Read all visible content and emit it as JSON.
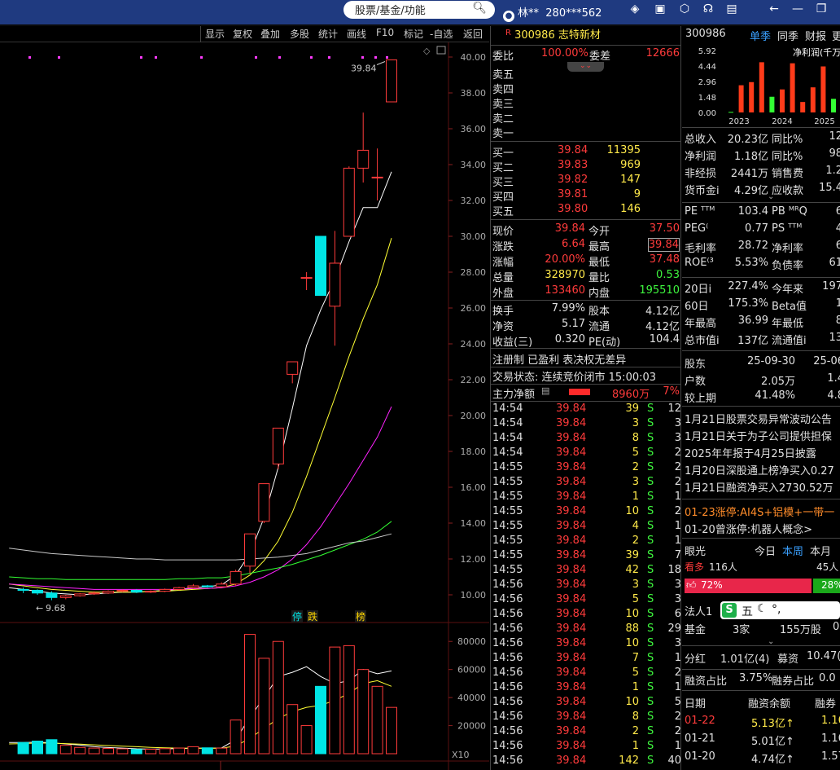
{
  "titlebar": {
    "search_placeholder": "股票/基金/功能",
    "user_name": "林**",
    "user_id": "280***562"
  },
  "chart_toolbar": [
    "显示",
    "复权",
    "叠加",
    "多股",
    "统计",
    "画线",
    "F10",
    "标记",
    "-自选",
    "返回"
  ],
  "chart_data": {
    "type": "candlestick",
    "price_ticks": [
      "40.00",
      "38.00",
      "36.00",
      "34.00",
      "32.00",
      "30.00",
      "28.00",
      "26.00",
      "24.00",
      "22.00",
      "20.00",
      "18.00",
      "16.00",
      "14.00",
      "12.00",
      "10.00"
    ],
    "volume_ticks": [
      "80000",
      "60000",
      "40000",
      "20000"
    ],
    "volume_unit": "X10",
    "price_range": [
      9.0,
      40.3
    ],
    "high_label": "39.84",
    "low_label": "9.68",
    "markers": [
      {
        "text": "停",
        "color": "#00e5e5"
      },
      {
        "text": "跌",
        "color": "#ffd700"
      },
      {
        "text": "榜",
        "color": "#ffd700"
      }
    ],
    "candles": [
      {
        "o": 10.3,
        "c": 10.25,
        "h": 10.4,
        "l": 10.1,
        "v": 8000
      },
      {
        "o": 10.25,
        "c": 10.1,
        "h": 10.3,
        "l": 10.0,
        "v": 9000
      },
      {
        "o": 10.1,
        "c": 9.85,
        "h": 10.2,
        "l": 9.7,
        "v": 10000
      },
      {
        "o": 9.85,
        "c": 9.95,
        "h": 10.0,
        "l": 9.75,
        "v": 6000
      },
      {
        "o": 9.95,
        "c": 10.05,
        "h": 10.1,
        "l": 9.9,
        "v": 4500
      },
      {
        "o": 10.05,
        "c": 10.1,
        "h": 10.2,
        "l": 10.0,
        "v": 4000
      },
      {
        "o": 10.1,
        "c": 10.2,
        "h": 10.25,
        "l": 10.05,
        "v": 3800
      },
      {
        "o": 10.2,
        "c": 10.25,
        "h": 10.3,
        "l": 10.15,
        "v": 3500
      },
      {
        "o": 10.25,
        "c": 10.15,
        "h": 10.3,
        "l": 10.1,
        "v": 3000
      },
      {
        "o": 10.15,
        "c": 10.2,
        "h": 10.25,
        "l": 10.1,
        "v": 3200
      },
      {
        "o": 10.2,
        "c": 10.3,
        "h": 10.35,
        "l": 10.15,
        "v": 3600
      },
      {
        "o": 10.3,
        "c": 10.4,
        "h": 10.45,
        "l": 10.25,
        "v": 4000
      },
      {
        "o": 10.4,
        "c": 10.5,
        "h": 10.6,
        "l": 10.35,
        "v": 5000
      },
      {
        "o": 10.5,
        "c": 10.45,
        "h": 10.55,
        "l": 10.4,
        "v": 4200
      },
      {
        "o": 10.45,
        "c": 10.6,
        "h": 10.7,
        "l": 10.4,
        "v": 4000
      },
      {
        "o": 10.6,
        "c": 11.3,
        "h": 11.4,
        "l": 10.5,
        "v": 24000
      },
      {
        "o": 11.6,
        "c": 13.4,
        "h": 13.4,
        "l": 11.2,
        "v": 85000
      },
      {
        "o": 14.1,
        "c": 16.2,
        "h": 16.2,
        "l": 14.0,
        "v": 68000
      },
      {
        "o": 17.3,
        "c": 19.3,
        "h": 19.3,
        "l": 17.0,
        "v": 80000
      },
      {
        "o": 22.3,
        "c": 23.0,
        "h": 23.0,
        "l": 21.8,
        "v": 35000
      },
      {
        "o": 27.7,
        "c": 27.7,
        "h": 28.0,
        "l": 27.0,
        "v": 20000
      },
      {
        "o": 30.0,
        "c": 26.7,
        "h": 30.0,
        "l": 26.7,
        "v": 48000
      },
      {
        "o": 26.1,
        "c": 28.5,
        "h": 30.3,
        "l": 23.9,
        "v": 76000
      },
      {
        "o": 30.0,
        "c": 33.8,
        "h": 33.9,
        "l": 30.0,
        "v": 77000
      },
      {
        "o": 33.8,
        "c": 34.8,
        "h": 36.9,
        "l": 33.0,
        "v": 60000
      },
      {
        "o": 33.3,
        "c": 33.3,
        "h": 34.9,
        "l": 32.0,
        "v": 48000
      },
      {
        "o": 37.5,
        "c": 39.84,
        "h": 39.84,
        "l": 37.48,
        "v": 33000
      }
    ],
    "ma_series": [
      {
        "color": "#ffffff",
        "values": [
          10.4,
          10.3,
          10.2,
          10.1,
          10.05,
          10.0,
          10.05,
          10.1,
          10.15,
          10.15,
          10.2,
          10.25,
          10.3,
          10.4,
          10.45,
          10.55,
          11.1,
          12.3,
          14.3,
          17.1,
          20.4,
          23.9,
          25.9,
          27.6,
          29.7,
          31.6,
          31.6,
          33.6
        ]
      },
      {
        "color": "#ffff33",
        "values": [
          10.6,
          10.5,
          10.4,
          10.3,
          10.25,
          10.2,
          10.15,
          10.15,
          10.15,
          10.15,
          10.2,
          10.2,
          10.25,
          10.3,
          10.35,
          10.4,
          10.6,
          11.1,
          11.9,
          13.0,
          14.6,
          16.6,
          18.8,
          21.0,
          23.3,
          25.4,
          27.3,
          29.9
        ]
      },
      {
        "color": "#ff22ff",
        "values": [
          10.6,
          10.55,
          10.5,
          10.45,
          10.4,
          10.35,
          10.3,
          10.3,
          10.3,
          10.3,
          10.3,
          10.3,
          10.3,
          10.35,
          10.35,
          10.4,
          10.5,
          10.7,
          11.0,
          11.4,
          12.0,
          12.8,
          13.8,
          15.0,
          16.2,
          17.5,
          18.8,
          20.5
        ]
      },
      {
        "color": "#33ff33",
        "values": [
          11.0,
          10.95,
          10.9,
          10.9,
          10.85,
          10.85,
          10.85,
          10.85,
          10.85,
          10.85,
          10.85,
          10.85,
          10.9,
          10.9,
          10.95,
          10.95,
          11.05,
          11.2,
          11.35,
          11.5,
          11.7,
          11.95,
          12.2,
          12.5,
          12.8,
          13.1,
          13.5,
          14.1
        ]
      },
      {
        "color": "#c8c8c8",
        "values": [
          12.6,
          12.5,
          12.4,
          12.3,
          12.25,
          12.2,
          12.15,
          12.1,
          12.05,
          12.0,
          12.0,
          11.95,
          11.95,
          11.95,
          11.95,
          11.95,
          11.95,
          12.0,
          12.05,
          12.1,
          12.2,
          12.3,
          12.5,
          12.7,
          12.9,
          13.0,
          13.2,
          13.4
        ]
      }
    ],
    "vol_ma_series": [
      {
        "color": "#ffffff",
        "values": [
          8000,
          8000,
          8200,
          7800,
          7000,
          6200,
          5000,
          4400,
          4000,
          3500,
          3300,
          3400,
          3700,
          3900,
          4000,
          4100,
          10000,
          26000,
          40000,
          55000,
          58000,
          62000,
          55000,
          50000,
          52000,
          60000,
          57000,
          59000
        ]
      },
      {
        "color": "#ffff33",
        "values": [
          7000,
          7200,
          7600,
          7500,
          7200,
          6800,
          6300,
          5800,
          5400,
          5000,
          4500,
          4200,
          4000,
          3900,
          3850,
          3900,
          5500,
          11000,
          18000,
          25000,
          30000,
          33000,
          34500,
          38000,
          43000,
          50000,
          52000,
          48000
        ]
      }
    ]
  },
  "quote": {
    "title_badge": "R",
    "code": "300986",
    "name": "志特新材",
    "weibi_label": "委比",
    "weibi": "100.00%",
    "weicha_label": "委差",
    "weicha": "12666",
    "sells": [
      {
        "label": "卖五"
      },
      {
        "label": "卖四"
      },
      {
        "label": "卖三"
      },
      {
        "label": "卖二"
      },
      {
        "label": "卖一"
      }
    ],
    "buys": [
      {
        "label": "买一",
        "price": "39.84",
        "vol": "11395"
      },
      {
        "label": "买二",
        "price": "39.83",
        "vol": "969"
      },
      {
        "label": "买三",
        "price": "39.82",
        "vol": "147"
      },
      {
        "label": "买四",
        "price": "39.81",
        "vol": "9"
      },
      {
        "label": "买五",
        "price": "39.80",
        "vol": "146"
      }
    ],
    "stats": [
      {
        "l1": "现价",
        "v1": "39.84",
        "c1": "red",
        "l2": "今开",
        "v2": "37.50",
        "c2": "red"
      },
      {
        "l1": "涨跌",
        "v1": "6.64",
        "c1": "red",
        "l2": "最高",
        "v2": "39.84",
        "c2": "red"
      },
      {
        "l1": "涨幅",
        "v1": "20.00%",
        "c1": "red",
        "l2": "最低",
        "v2": "37.48",
        "c2": "red"
      },
      {
        "l1": "总量",
        "v1": "328970",
        "c1": "yel",
        "l2": "量比",
        "v2": "0.53",
        "c2": "grn"
      },
      {
        "l1": "外盘",
        "v1": "133460",
        "c1": "red",
        "l2": "内盘",
        "v2": "195510",
        "c2": "grn"
      }
    ],
    "stats2": [
      {
        "l1": "换手",
        "v1": "7.99%",
        "l2": "股本",
        "v2": "4.12亿"
      },
      {
        "l1": "净资",
        "v1": "5.17",
        "l2": "流通",
        "v2": "4.12亿"
      },
      {
        "l1": "收益(三)",
        "v1": "0.320",
        "l2": "PE(动)",
        "v2": "104.4"
      }
    ],
    "tags": "注册制 已盈利 表决权无差异",
    "trade_status": "交易状态: 连续竞价闭市 15:00:03",
    "main_flow_label": "主力净额",
    "main_flow_value": "8960万",
    "main_flow_pct": "7%",
    "ticks": [
      {
        "t": "14:54",
        "p": "39.84",
        "v": "39",
        "s": "S",
        "n": "12"
      },
      {
        "t": "14:54",
        "p": "39.84",
        "v": "3",
        "s": "S",
        "n": "3"
      },
      {
        "t": "14:54",
        "p": "39.84",
        "v": "8",
        "s": "S",
        "n": "3"
      },
      {
        "t": "14:54",
        "p": "39.84",
        "v": "5",
        "s": "S",
        "n": "2"
      },
      {
        "t": "14:55",
        "p": "39.84",
        "v": "2",
        "s": "S",
        "n": "2"
      },
      {
        "t": "14:55",
        "p": "39.84",
        "v": "3",
        "s": "S",
        "n": "2"
      },
      {
        "t": "14:55",
        "p": "39.84",
        "v": "1",
        "s": "S",
        "n": "1"
      },
      {
        "t": "14:55",
        "p": "39.84",
        "v": "10",
        "s": "S",
        "n": "2"
      },
      {
        "t": "14:55",
        "p": "39.84",
        "v": "4",
        "s": "S",
        "n": "1"
      },
      {
        "t": "14:55",
        "p": "39.84",
        "v": "2",
        "s": "S",
        "n": "1"
      },
      {
        "t": "14:55",
        "p": "39.84",
        "v": "39",
        "s": "S",
        "n": "7"
      },
      {
        "t": "14:55",
        "p": "39.84",
        "v": "42",
        "s": "S",
        "n": "18"
      },
      {
        "t": "14:56",
        "p": "39.84",
        "v": "3",
        "s": "S",
        "n": "3"
      },
      {
        "t": "14:56",
        "p": "39.84",
        "v": "5",
        "s": "S",
        "n": "3"
      },
      {
        "t": "14:56",
        "p": "39.84",
        "v": "10",
        "s": "S",
        "n": "6"
      },
      {
        "t": "14:56",
        "p": "39.84",
        "v": "88",
        "s": "S",
        "n": "29"
      },
      {
        "t": "14:56",
        "p": "39.84",
        "v": "10",
        "s": "S",
        "n": "3"
      },
      {
        "t": "14:56",
        "p": "39.84",
        "v": "7",
        "s": "S",
        "n": "1"
      },
      {
        "t": "14:56",
        "p": "39.84",
        "v": "5",
        "s": "S",
        "n": "2"
      },
      {
        "t": "14:56",
        "p": "39.84",
        "v": "1",
        "s": "S",
        "n": "1"
      },
      {
        "t": "14:56",
        "p": "39.84",
        "v": "10",
        "s": "S",
        "n": "5"
      },
      {
        "t": "14:56",
        "p": "39.84",
        "v": "8",
        "s": "S",
        "n": "2"
      },
      {
        "t": "14:56",
        "p": "39.84",
        "v": "2",
        "s": "S",
        "n": "2"
      },
      {
        "t": "14:56",
        "p": "39.84",
        "v": "1",
        "s": "S",
        "n": "1"
      },
      {
        "t": "14:56",
        "p": "39.84",
        "v": "142",
        "s": "S",
        "n": "40"
      }
    ]
  },
  "right": {
    "code": "300986",
    "tabs": [
      "单季",
      "同季",
      "财报",
      "更"
    ],
    "mini_chart": {
      "title": "净利润(千万",
      "y_ticks": [
        "5.92",
        "4.44",
        "2.96",
        "1.48",
        "0.00"
      ],
      "years": [
        "2023",
        "2024",
        "2025"
      ],
      "bars": [
        {
          "v": 0.05,
          "c": "#33ff33"
        },
        {
          "v": 2.6,
          "c": "#ff3b1a"
        },
        {
          "v": 2.9,
          "c": "#ff3b1a"
        },
        {
          "v": 4.8,
          "c": "#ff3b1a"
        },
        {
          "v": 1.5,
          "c": "#33ff33"
        },
        {
          "v": 2.2,
          "c": "#ff3b1a"
        },
        {
          "v": 4.7,
          "c": "#ff3b1a"
        },
        {
          "v": 1.0,
          "c": "#ff3b1a"
        },
        {
          "v": 2.4,
          "c": "#ff3b1a"
        },
        {
          "v": 4.4,
          "c": "#ff3b1a"
        },
        {
          "v": 1.3,
          "c": "#33ff33"
        }
      ]
    },
    "fin_rows": [
      {
        "l": "总收入",
        "v": "20.23亿",
        "l2": "同比%",
        "v2": "12",
        "vc": "wht",
        "v2c": "wht"
      },
      {
        "l": "净利润",
        "v": "1.18亿",
        "l2": "同比%",
        "v2": "98",
        "vc": "wht",
        "v2c": "wht"
      },
      {
        "l": "非经损",
        "v": "2441万",
        "l2": "销售费",
        "v2": "1.2",
        "vc": "wht",
        "v2c": "wht"
      },
      {
        "l": "货币金i",
        "v": "4.29亿",
        "l2": "应收款",
        "v2": "15.4",
        "vc": "wht",
        "v2c": "wht"
      }
    ],
    "val_rows": [
      {
        "l": "PE ᵀᵀᴹ",
        "v": "103.4",
        "l2": "PB ᴹᴿQ",
        "v2": "6"
      },
      {
        "l": "PEG⁽",
        "v": "0.77",
        "l2": "PS ᵀᵀᴹ",
        "v2": "4"
      },
      {
        "l": "毛利率",
        "v": "28.72",
        "l2": "净利率",
        "v2": "6"
      },
      {
        "l": "ROE⁽³",
        "v": "5.53%",
        "l2": "负债率",
        "v2": "61"
      }
    ],
    "perf_rows": [
      {
        "l": "20日i",
        "v": "227.4%",
        "l2": "今年来",
        "v2": "197"
      },
      {
        "l": "60日",
        "v": "175.3%",
        "l2": "Beta值",
        "v2": "1"
      },
      {
        "l": "年最高",
        "v": "36.99",
        "l2": "年最低",
        "v2": "8"
      },
      {
        "l": "总市值i",
        "v": "137亿",
        "l2": "流通值i",
        "v2": "13"
      }
    ],
    "holder_rows": [
      {
        "l": "股东",
        "v": "25-09-30",
        "v2": "25-06"
      },
      {
        "l": "户数",
        "v": "2.05万",
        "v2": "1.4"
      },
      {
        "l": "较上期",
        "v": "41.48%",
        "v2": "4.8"
      }
    ],
    "news": [
      "1月21日股票交易异常波动公告",
      "1月21日关于为子公司提供担保",
      "2025年年报于4月25日披露",
      "1月20日深股通上榜净买入0.27",
      "1月21日融资净买入2730.52万"
    ],
    "limit_up": "01-23涨停:AI4S+铝模+一带一",
    "limit_up2": "01-20曾涨停:机器人概念>",
    "eye_label": "眼光",
    "eye_tabs": [
      "今日",
      "本周",
      "本月"
    ],
    "bull_label": "看多",
    "bull_count": "116人",
    "bear_count": "45人",
    "bull_pct": "72%",
    "bear_pct": "28%",
    "inst_label1": "法人1",
    "inst_label2": "基金",
    "inst_val": "3家",
    "inst_val2": "155万股",
    "inst_val3": "0",
    "fenhong": {
      "l": "分红",
      "v": "1.01亿(4)",
      "l2": "募资",
      "v2": "10.47("
    },
    "rongzi": {
      "l": "融资占比",
      "v": "3.75%",
      "l2": "融券占比",
      "v2": "0.0"
    },
    "margin_head": [
      "日期",
      "融资余额",
      "融券"
    ],
    "margin_rows": [
      {
        "d": "01-22",
        "v": "5.13亿↑",
        "v2": "1.16",
        "hl": true
      },
      {
        "d": "01-21",
        "v": "5.01亿↑",
        "v2": "1.16",
        "hl": false
      },
      {
        "d": "01-20",
        "v": "4.74亿↑",
        "v2": "1.57",
        "hl": false
      }
    ]
  }
}
